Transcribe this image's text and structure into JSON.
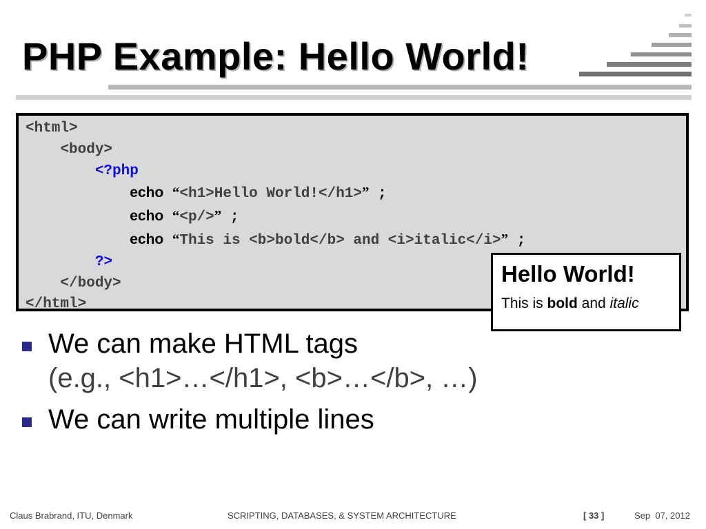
{
  "slide": {
    "title": "PHP Example: Hello World!"
  },
  "code": {
    "l1": "<html>",
    "l2": "<body>",
    "l3": "<?php",
    "echo": "echo",
    "oq": "“",
    "cq": "”",
    "semi": " ;",
    "l4_str": "<h1>Hello World!</h1>",
    "l5_str": "<p/>",
    "l6_str": "This is <b>bold</b> and <i>italic</i>",
    "l7": "?>",
    "l8": "</body>",
    "l9": "</html>"
  },
  "result": {
    "heading": "Hello World!",
    "text_prefix": "This is ",
    "bold": "bold",
    "text_mid": " and ",
    "italic": "italic"
  },
  "bullets": [
    {
      "line1": "We can make HTML tags",
      "line2": "(e.g., <h1>…</h1>, <b>…</b>, …)"
    },
    {
      "line1": "We can write multiple lines"
    }
  ],
  "footer": {
    "author": "Claus Brabrand, ITU, Denmark",
    "course": "SCRIPTING, DATABASES, & SYSTEM ARCHITECTURE",
    "page": "[ 33 ]",
    "date": "Sep  07, 2012"
  },
  "colors": {
    "code_bg": "#d9d9d9",
    "php_tag": "#1010e0",
    "bullet": "#2a2a8c"
  }
}
